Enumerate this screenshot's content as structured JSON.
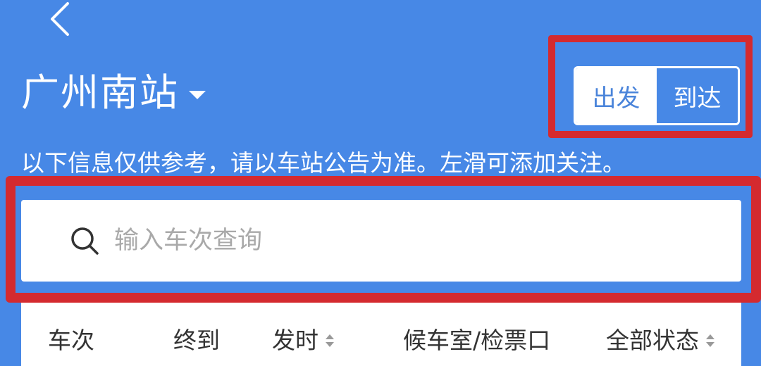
{
  "header": {
    "back_icon": "chevron-left-icon",
    "station": "广州南站",
    "dropdown_icon": "caret-down-icon"
  },
  "toggle": {
    "depart": "出发",
    "arrive": "到达",
    "selected": "depart"
  },
  "notice": "以下信息仅供参考，请以车站公告为准。左滑可添加关注。",
  "search": {
    "icon": "search-icon",
    "placeholder": "输入车次查询",
    "value": ""
  },
  "table": {
    "columns": [
      {
        "label": "车次",
        "sortable": false
      },
      {
        "label": "终到",
        "sortable": false
      },
      {
        "label": "发时",
        "sortable": true
      },
      {
        "label": "候车室/检票口",
        "sortable": false
      },
      {
        "label": "全部状态",
        "sortable": true
      }
    ]
  },
  "colors": {
    "background": "#4788e6",
    "annotation": "#d42a2f",
    "text_light": "#ffffff",
    "text_dark": "#333333"
  }
}
